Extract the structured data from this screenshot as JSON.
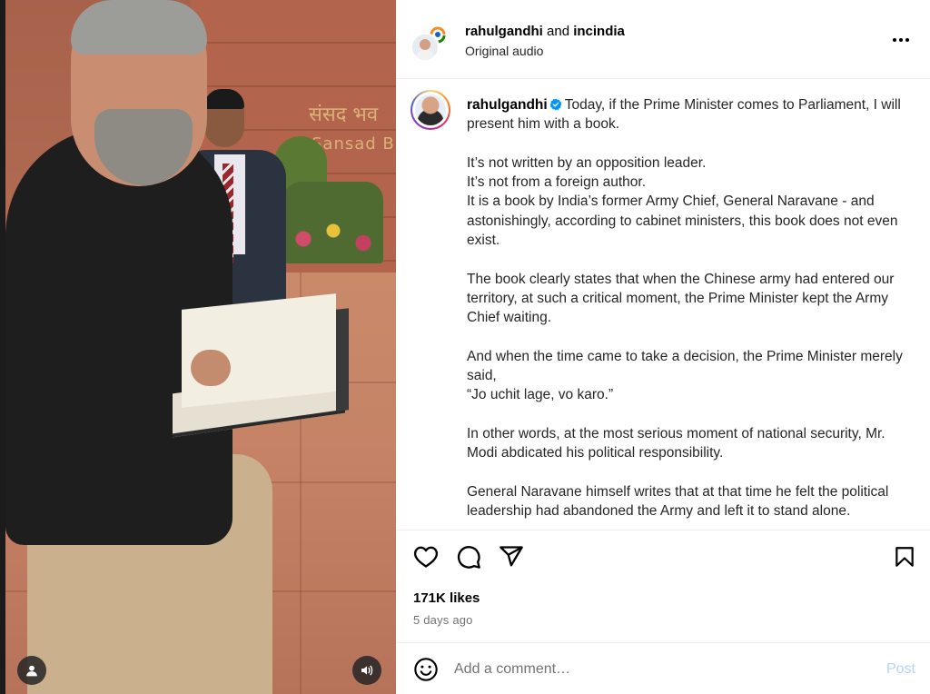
{
  "media": {
    "wall_sign_hindi": "संसद भव",
    "wall_sign_english": "Sansad B",
    "user_tags_icon": "person-icon",
    "audio_icon": "speaker-icon"
  },
  "header": {
    "author": "rahulgandhi",
    "joiner": "and",
    "collaborator": "incindia",
    "subtitle": "Original audio",
    "more_icon": "more-horizontal-icon"
  },
  "caption": {
    "username": "rahulgandhi",
    "verified": true,
    "paragraphs": [
      "Today, if the Prime Minister comes to Parliament, I will present him with a book.",
      "It’s not written by an opposition leader.",
      "It’s not from a foreign author.",
      "It is a book by India’s former Army Chief, General Naravane - and astonishingly, according to cabinet ministers, this book does not even exist.",
      "The book clearly states that when the Chinese army had entered our territory, at such a critical moment, the Prime Minister kept the Army Chief waiting.",
      "And when the time came to take a decision, the Prime Minister merely said,",
      "“Jo uchit lage, vo karo.”",
      "In other words, at the most serious moment of national security, Mr. Modi abdicated his political responsibility.",
      "General Naravane himself writes that at that time he felt the political leadership had abandoned the Army and left it to stand alone."
    ]
  },
  "actions": {
    "like_icon": "heart-icon",
    "comment_icon": "comment-icon",
    "share_icon": "send-icon",
    "save_icon": "bookmark-icon"
  },
  "stats": {
    "likes": "171K likes",
    "time_ago": "5 days ago"
  },
  "comment": {
    "emoji_icon": "emoji-icon",
    "placeholder": "Add a comment…",
    "post_label": "Post"
  },
  "colors": {
    "verified_blue": "#0095f6",
    "post_disabled": "#b3d4fc",
    "secondary_text": "#737373"
  }
}
